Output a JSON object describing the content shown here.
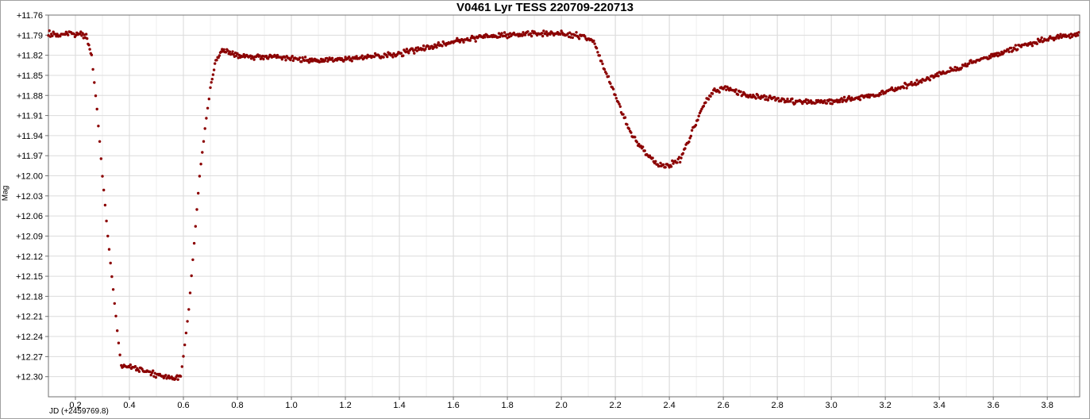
{
  "chart_data": {
    "type": "scatter",
    "title": "V0461 Lyr TESS 220709-220713",
    "xlabel": "JD (+2459769.8)",
    "ylabel": "Mag",
    "xlim": [
      0.1,
      3.92
    ],
    "ylim": [
      11.76,
      12.33
    ],
    "y_inverted": true,
    "grid": true,
    "marker_color": "#8b0000",
    "x_ticks": [
      0.2,
      0.4,
      0.6,
      0.8,
      1.0,
      1.2,
      1.4,
      1.6,
      1.8,
      2.0,
      2.2,
      2.4,
      2.6,
      2.8,
      3.0,
      3.2,
      3.4,
      3.6,
      3.8
    ],
    "x_tick_labels": [
      "0.2",
      "0.4",
      "0.6",
      "0.8",
      "1.0",
      "1.2",
      "1.4",
      "1.6",
      "1.8",
      "2.0",
      "2.2",
      "2.4",
      "2.6",
      "2.8",
      "3.0",
      "3.2",
      "3.4",
      "3.6",
      "3.8"
    ],
    "y_ticks": [
      11.76,
      11.79,
      11.82,
      11.85,
      11.88,
      11.91,
      11.94,
      11.97,
      12.0,
      12.03,
      12.06,
      12.09,
      12.12,
      12.15,
      12.18,
      12.21,
      12.24,
      12.27,
      12.3
    ],
    "y_tick_labels": [
      "+11.76",
      "+11.79",
      "+11.82",
      "+11.85",
      "+11.88",
      "+11.91",
      "+11.94",
      "+11.97",
      "+12.00",
      "+12.03",
      "+12.06",
      "+12.09",
      "+12.12",
      "+12.15",
      "+12.18",
      "+12.21",
      "+12.24",
      "+12.27",
      "+12.30"
    ],
    "series": [
      {
        "points": [
          [
            0.1,
            11.789
          ],
          [
            0.14,
            11.789
          ],
          [
            0.18,
            11.788
          ],
          [
            0.22,
            11.789
          ],
          [
            0.24,
            11.792
          ],
          [
            0.26,
            11.82
          ],
          [
            0.28,
            11.9
          ],
          [
            0.3,
            12.0
          ],
          [
            0.32,
            12.09
          ],
          [
            0.34,
            12.17
          ],
          [
            0.36,
            12.25
          ],
          [
            0.37,
            12.284
          ],
          [
            0.4,
            12.285
          ],
          [
            0.44,
            12.29
          ],
          [
            0.48,
            12.295
          ],
          [
            0.52,
            12.298
          ],
          [
            0.56,
            12.303
          ],
          [
            0.59,
            12.3
          ],
          [
            0.6,
            12.27
          ],
          [
            0.62,
            12.2
          ],
          [
            0.64,
            12.1
          ],
          [
            0.66,
            12.0
          ],
          [
            0.68,
            11.93
          ],
          [
            0.7,
            11.87
          ],
          [
            0.72,
            11.83
          ],
          [
            0.74,
            11.812
          ],
          [
            0.8,
            11.82
          ],
          [
            0.9,
            11.822
          ],
          [
            1.0,
            11.825
          ],
          [
            1.1,
            11.828
          ],
          [
            1.2,
            11.826
          ],
          [
            1.3,
            11.822
          ],
          [
            1.4,
            11.817
          ],
          [
            1.5,
            11.808
          ],
          [
            1.6,
            11.8
          ],
          [
            1.7,
            11.793
          ],
          [
            1.8,
            11.79
          ],
          [
            1.9,
            11.787
          ],
          [
            2.0,
            11.788
          ],
          [
            2.08,
            11.792
          ],
          [
            2.12,
            11.8
          ],
          [
            2.16,
            11.84
          ],
          [
            2.2,
            11.88
          ],
          [
            2.24,
            11.92
          ],
          [
            2.28,
            11.95
          ],
          [
            2.32,
            11.97
          ],
          [
            2.36,
            11.984
          ],
          [
            2.4,
            11.985
          ],
          [
            2.44,
            11.975
          ],
          [
            2.48,
            11.94
          ],
          [
            2.52,
            11.9
          ],
          [
            2.56,
            11.875
          ],
          [
            2.6,
            11.868
          ],
          [
            2.64,
            11.874
          ],
          [
            2.7,
            11.88
          ],
          [
            2.8,
            11.886
          ],
          [
            2.9,
            11.89
          ],
          [
            3.0,
            11.889
          ],
          [
            3.1,
            11.884
          ],
          [
            3.2,
            11.875
          ],
          [
            3.3,
            11.863
          ],
          [
            3.4,
            11.848
          ],
          [
            3.5,
            11.834
          ],
          [
            3.6,
            11.821
          ],
          [
            3.7,
            11.806
          ],
          [
            3.8,
            11.795
          ],
          [
            3.92,
            11.789
          ]
        ]
      }
    ]
  }
}
